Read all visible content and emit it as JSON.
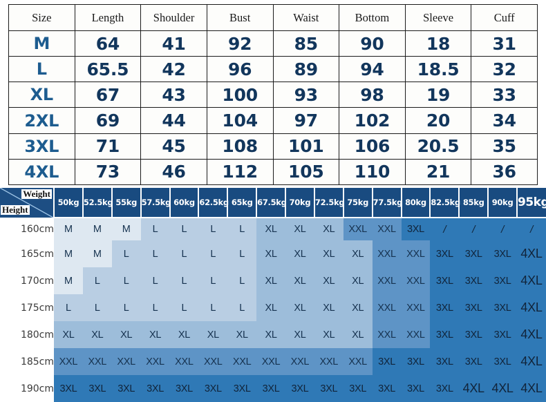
{
  "measurement_table": {
    "headers": [
      "Size",
      "Length",
      "Shoulder",
      "Bust",
      "Waist",
      "Bottom",
      "Sleeve",
      "Cuff"
    ],
    "rows": [
      {
        "size": "M",
        "length": "64",
        "shoulder": "41",
        "bust": "92",
        "waist": "85",
        "bottom": "90",
        "sleeve": "18",
        "cuff": "31"
      },
      {
        "size": "L",
        "length": "65.5",
        "shoulder": "42",
        "bust": "96",
        "waist": "89",
        "bottom": "94",
        "sleeve": "18.5",
        "cuff": "32"
      },
      {
        "size": "XL",
        "length": "67",
        "shoulder": "43",
        "bust": "100",
        "waist": "93",
        "bottom": "98",
        "sleeve": "19",
        "cuff": "33"
      },
      {
        "size": "2XL",
        "length": "69",
        "shoulder": "44",
        "bust": "104",
        "waist": "97",
        "bottom": "102",
        "sleeve": "20",
        "cuff": "34"
      },
      {
        "size": "3XL",
        "length": "71",
        "shoulder": "45",
        "bust": "108",
        "waist": "101",
        "bottom": "106",
        "sleeve": "20.5",
        "cuff": "35"
      },
      {
        "size": "4XL",
        "length": "73",
        "shoulder": "46",
        "bust": "112",
        "waist": "105",
        "bottom": "110",
        "sleeve": "21",
        "cuff": "36"
      }
    ]
  },
  "size_grid": {
    "corner": {
      "weight_label": "Weight",
      "height_label": "Height"
    },
    "weight_headers": [
      "50kg",
      "52.5kg",
      "55kg",
      "57.5kg",
      "60kg",
      "62.5kg",
      "65kg",
      "67.5kg",
      "70kg",
      "72.5kg",
      "75kg",
      "77.5kg",
      "80kg",
      "82.5kg",
      "85kg",
      "90kg",
      "95kg"
    ],
    "weight_header_emphasis_index": 16,
    "height_headers": [
      "160cm",
      "165cm",
      "170cm",
      "175cm",
      "180cm",
      "185cm",
      "190cm"
    ],
    "rows": [
      [
        "M",
        "M",
        "M",
        "L",
        "L",
        "L",
        "L",
        "XL",
        "XL",
        "XL",
        "XXL",
        "XXL",
        "3XL",
        "/",
        "/",
        "/",
        "/"
      ],
      [
        "M",
        "M",
        "L",
        "L",
        "L",
        "L",
        "L",
        "XL",
        "XL",
        "XL",
        "XL",
        "XXL",
        "XXL",
        "3XL",
        "3XL",
        "3XL",
        "4XL"
      ],
      [
        "M",
        "L",
        "L",
        "L",
        "L",
        "L",
        "L",
        "XL",
        "XL",
        "XL",
        "XL",
        "XXL",
        "XXL",
        "3XL",
        "3XL",
        "3XL",
        "4XL"
      ],
      [
        "L",
        "L",
        "L",
        "L",
        "L",
        "L",
        "L",
        "XL",
        "XL",
        "XL",
        "XL",
        "XXL",
        "XXL",
        "3XL",
        "3XL",
        "3XL",
        "4XL"
      ],
      [
        "XL",
        "XL",
        "XL",
        "XL",
        "XL",
        "XL",
        "XL",
        "XL",
        "XL",
        "XL",
        "XL",
        "XXL",
        "XXL",
        "3XL",
        "3XL",
        "3XL",
        "4XL"
      ],
      [
        "XXL",
        "XXL",
        "XXL",
        "XXL",
        "XXL",
        "XXL",
        "XXL",
        "XXL",
        "XXL",
        "XXL",
        "XXL",
        "3XL",
        "3XL",
        "3XL",
        "3XL",
        "3XL",
        "4XL"
      ],
      [
        "3XL",
        "3XL",
        "3XL",
        "3XL",
        "3XL",
        "3XL",
        "3XL",
        "3XL",
        "3XL",
        "3XL",
        "3XL",
        "3XL",
        "3XL",
        "3XL",
        "4XL",
        "4XL",
        "4XL"
      ]
    ],
    "big_cells": {
      "0": [],
      "1": [
        16
      ],
      "2": [
        16
      ],
      "3": [
        16
      ],
      "4": [
        16
      ],
      "5": [
        16
      ],
      "6": [
        14,
        15,
        16
      ]
    }
  },
  "colors": {
    "header_blue": "#194b80",
    "corner_blue": "#1d4e83",
    "tier_m": "#dee8f1",
    "tier_l": "#b9cee3",
    "tier_xl": "#9dbdda",
    "tier_xxl": "#5e94c6",
    "tier_3xl": "#2f79b6",
    "value_navy": "#12365c",
    "size_blue": "#1d5c8f"
  }
}
